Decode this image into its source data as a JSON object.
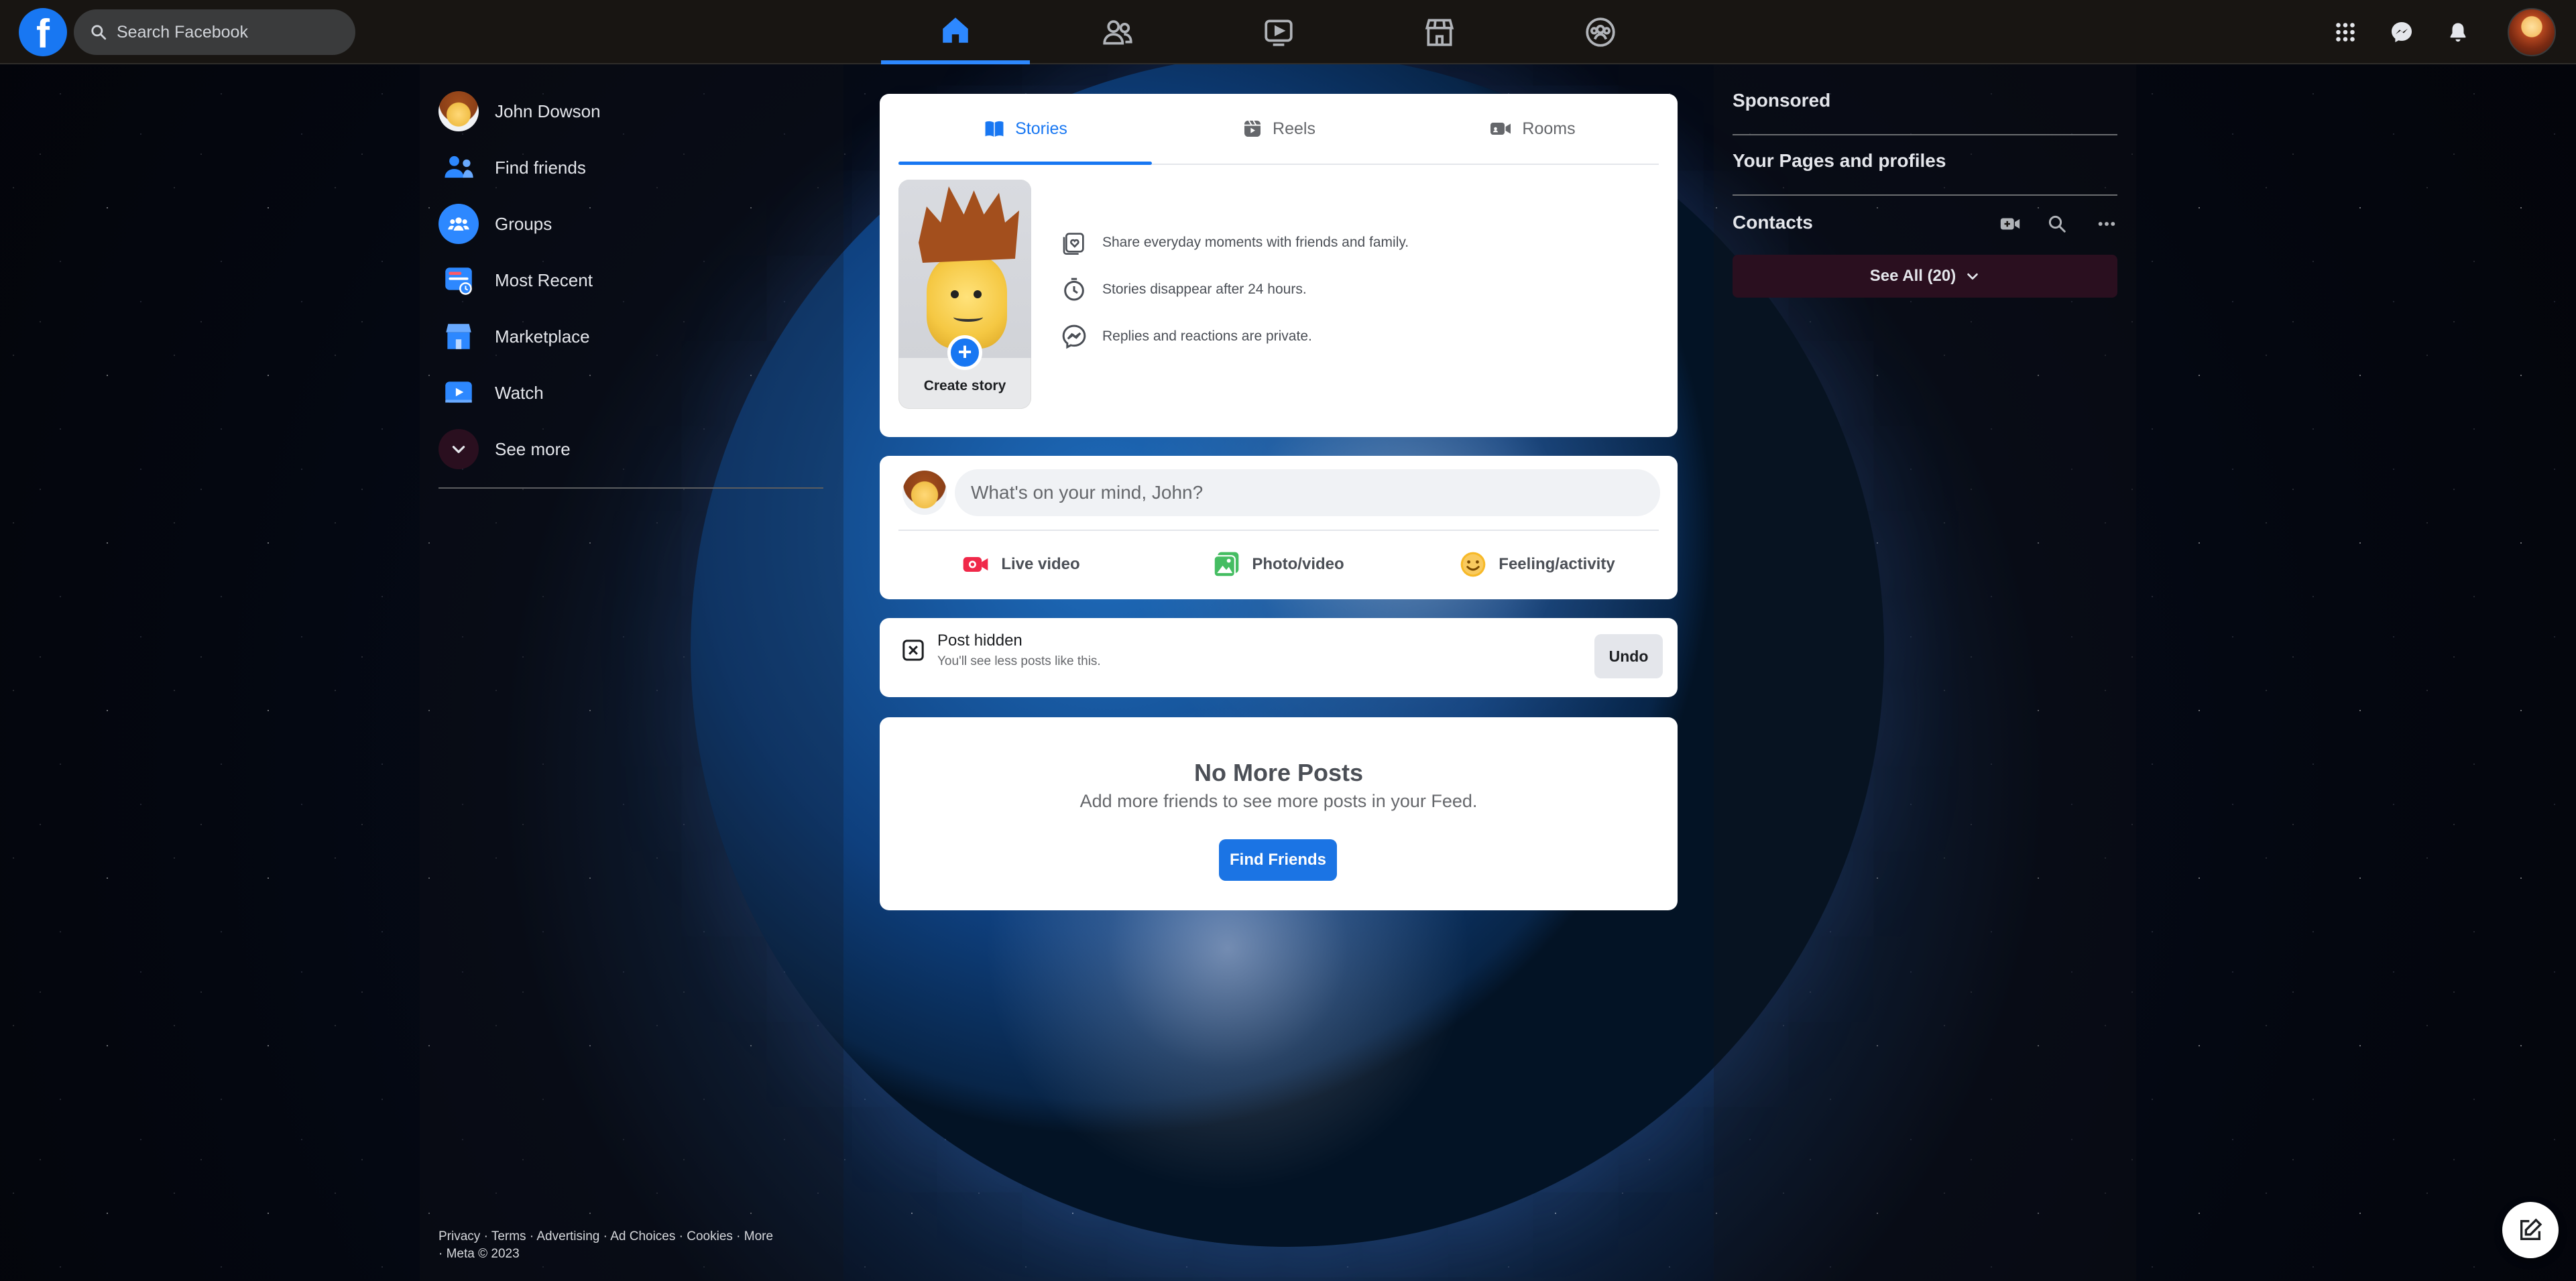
{
  "topbar": {
    "logo_letter": "f",
    "search_placeholder": "Search Facebook",
    "nav_tabs": [
      {
        "name": "home",
        "icon": "home-icon",
        "active": true
      },
      {
        "name": "friends",
        "icon": "friends-icon",
        "active": false
      },
      {
        "name": "watch",
        "icon": "video-icon",
        "active": false
      },
      {
        "name": "marketplace",
        "icon": "marketplace-icon",
        "active": false
      },
      {
        "name": "groups",
        "icon": "groups-icon",
        "active": false
      }
    ],
    "right_icons": [
      "menu-grid-icon",
      "messenger-icon",
      "bell-icon"
    ]
  },
  "sidebar": {
    "items": [
      {
        "label": "John Dowson",
        "icon": "profile-avatar"
      },
      {
        "label": "Find friends",
        "icon": "friends-icon"
      },
      {
        "label": "Groups",
        "icon": "groups-icon"
      },
      {
        "label": "Most Recent",
        "icon": "feed-icon"
      },
      {
        "label": "Marketplace",
        "icon": "marketplace-icon"
      },
      {
        "label": "Watch",
        "icon": "watch-icon"
      },
      {
        "label": "See more",
        "icon": "chevron-down-icon"
      }
    ],
    "footer_line1": "Privacy · Terms · Advertising · Ad Choices    · Cookies · More",
    "footer_line2": "· Meta © 2023"
  },
  "stories": {
    "tabs": [
      {
        "label": "Stories",
        "active": true
      },
      {
        "label": "Reels",
        "active": false
      },
      {
        "label": "Rooms",
        "active": false
      }
    ],
    "create_label": "Create story",
    "info": [
      "Share everyday moments with friends and family.",
      "Stories disappear after 24 hours.",
      "Replies and reactions are private."
    ]
  },
  "composer": {
    "placeholder": "What's on your mind, John?",
    "actions": [
      "Live video",
      "Photo/video",
      "Feeling/activity"
    ]
  },
  "hidden_post": {
    "title": "Post hidden",
    "subtitle": "You'll see less posts like this.",
    "undo": "Undo"
  },
  "no_more": {
    "title": "No More Posts",
    "subtitle": "Add more friends to see more posts in your Feed.",
    "button": "Find Friends"
  },
  "right": {
    "sponsored": "Sponsored",
    "pages": "Your Pages and profiles",
    "contacts": "Contacts",
    "see_all": "See All (20)"
  },
  "colors": {
    "accent": "#1877f2",
    "topbar": "#181512",
    "see_all_bg": "#2a0f1f"
  }
}
